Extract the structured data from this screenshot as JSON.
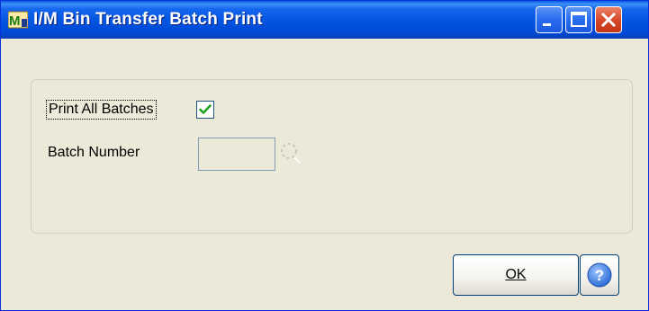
{
  "window": {
    "title": "I/M Bin Transfer Batch Print",
    "app_icon": "sage-mas-app-icon",
    "controls": [
      "minimize-icon",
      "maximize-icon",
      "close-icon"
    ]
  },
  "form": {
    "print_all_batches_label": "Print All Batches",
    "print_all_batches_checked": true,
    "batch_number_label": "Batch Number",
    "batch_number_value": "",
    "batch_lookup_icon": "lookup-icon"
  },
  "buttons": {
    "ok_label": "OK",
    "help_icon": "help-icon"
  },
  "colors": {
    "titlebar": "#0354e0",
    "window_bg": "#ece9d8",
    "check_mark": "#21a121",
    "help_blue": "#2f6dd6"
  }
}
